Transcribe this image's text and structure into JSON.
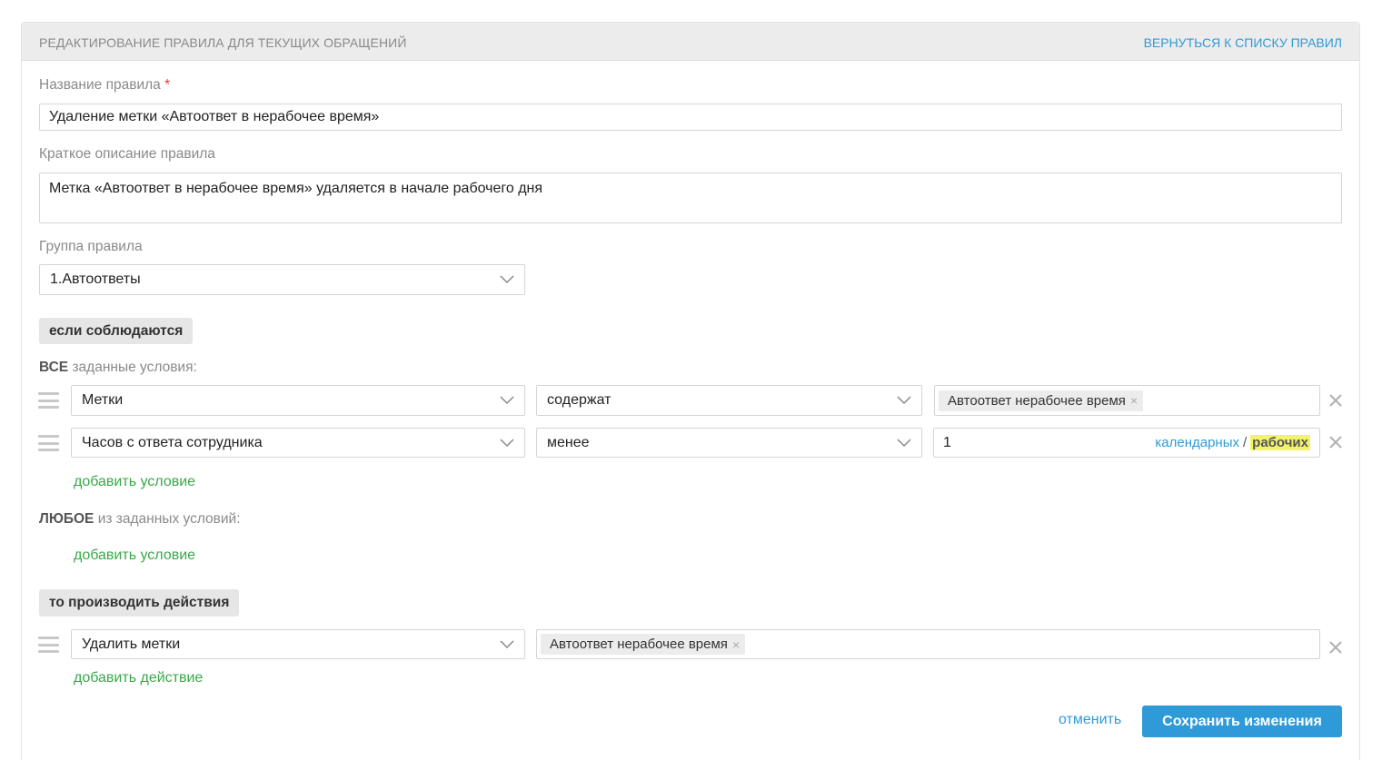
{
  "header": {
    "title": "РЕДАКТИРОВАНИЕ ПРАВИЛА ДЛЯ ТЕКУЩИХ ОБРАЩЕНИЙ",
    "back_link": "ВЕРНУТЬСЯ К СПИСКУ ПРАВИЛ"
  },
  "form": {
    "name_label": "Название правила",
    "required_mark": "*",
    "name_value": "Удаление метки «Автоответ в нерабочее время»",
    "description_label": "Краткое описание правила",
    "description_value": "Метка «Автоответ в нерабочее время» удаляется в начале рабочего дня",
    "group_label": "Группа правила",
    "group_value": "1.Автоответы"
  },
  "conditions": {
    "section_label": "если соблюдаются",
    "all_prefix": "ВСЕ",
    "all_suffix": "заданные условия:",
    "rows": [
      {
        "field": "Метки",
        "operator": "содержат",
        "tag": "Автоответ нерабочее время"
      },
      {
        "field": "Часов с ответа сотрудника",
        "operator": "менее",
        "value": "1",
        "calendar_label": "календарных",
        "separator": "/",
        "working_label": "рабочих"
      }
    ],
    "add_condition_all": "добавить условие",
    "any_prefix": "ЛЮБОЕ",
    "any_suffix": "из заданных условий:",
    "add_condition_any": "добавить условие"
  },
  "actions": {
    "section_label": "то производить действия",
    "rows": [
      {
        "action": "Удалить метки",
        "tag": "Автоответ нерабочее время"
      }
    ],
    "add_action": "добавить действие"
  },
  "footer": {
    "cancel": "отменить",
    "save": "Сохранить изменения"
  },
  "icons": {
    "remove": "close-icon",
    "drag": "drag-handle-icon",
    "dropdown": "chevron-down-icon",
    "tag_remove": "×"
  },
  "colors": {
    "accent": "#2f9ad8",
    "link_green": "#3aa84a",
    "highlight": "#f2f36b",
    "required": "#e33"
  }
}
